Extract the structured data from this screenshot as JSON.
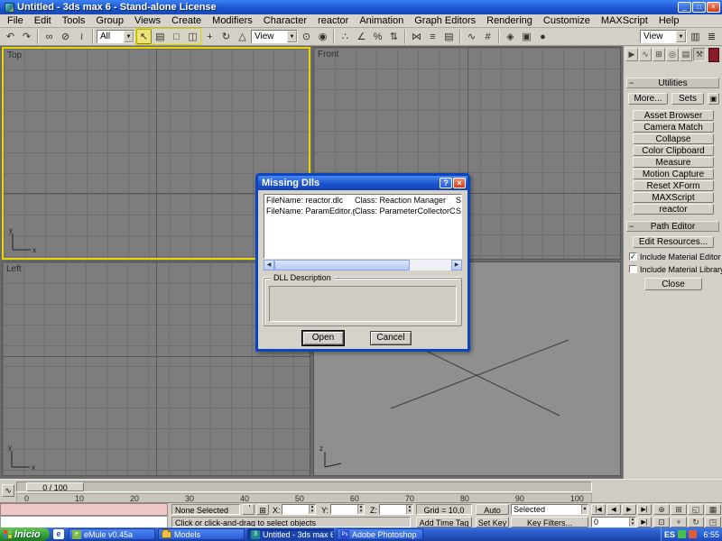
{
  "window": {
    "title": "Untitled - 3ds max 6 - Stand-alone License"
  },
  "menubar": {
    "items": [
      "File",
      "Edit",
      "Tools",
      "Group",
      "Views",
      "Create",
      "Modifiers",
      "Character",
      "reactor",
      "Animation",
      "Graph Editors",
      "Rendering",
      "Customize",
      "MAXScript",
      "Help"
    ]
  },
  "toolbar": {
    "selection_filter": "All",
    "ref_coord": "View",
    "view_right": "View"
  },
  "viewports": {
    "top_label": "Top",
    "front_label": "Front",
    "left_label": "Left",
    "axis_x": "x",
    "axis_y": "y",
    "axis_z": "z"
  },
  "command_panel": {
    "utilities_header": "Utilities",
    "more_label": "More...",
    "sets_label": "Sets",
    "buttons": [
      "Asset Browser",
      "Camera Match",
      "Collapse",
      "Color Clipboard",
      "Measure",
      "Motion Capture",
      "Reset XForm",
      "MAXScript",
      "reactor"
    ],
    "path_editor_header": "Path Editor",
    "edit_resources_label": "Edit Resources...",
    "chk_material_editor": "Include Material Editor",
    "chk_material_library": "Include Material Library",
    "close_label": "Close"
  },
  "dialog": {
    "title": "Missing Dlls",
    "rows": [
      {
        "filename": "FileName: reactor.dlc",
        "klass": "Class: Reaction Manager",
        "superclass": "SuperClass: G"
      },
      {
        "filename": "FileName: ParamEditor.gup",
        "klass": "Class: ParameterCollectorCA",
        "superclass": "SuperClass: G"
      }
    ],
    "group_label": "DLL Description",
    "open_label": "Open",
    "cancel_label": "Cancel"
  },
  "timeline": {
    "slider_label": "0 / 100",
    "ticks": [
      "0",
      "10",
      "20",
      "30",
      "40",
      "50",
      "60",
      "70",
      "80",
      "90",
      "100"
    ]
  },
  "statusbar": {
    "selection_status": "None Selected",
    "x_label": "X:",
    "y_label": "Y:",
    "z_label": "Z:",
    "x_value": "",
    "y_value": "",
    "z_value": "",
    "grid_status": "Grid = 10,0",
    "time_tag": "Add Time Tag",
    "prompt": "Click or click-and-drag to select objects",
    "auto_key": "Auto Key",
    "set_key": "Set Key",
    "key_mode": "Selected",
    "key_filters": "Key Filters...",
    "frame": "0"
  },
  "taskbar": {
    "start": "Inicio",
    "tasks": [
      {
        "label": "eMule v0.45a",
        "icon_text": "e"
      },
      {
        "label": "Models",
        "icon_text": ""
      },
      {
        "label": "Untitled - 3ds max 6 -...",
        "icon_text": "3"
      },
      {
        "label": "Adobe Photoshop",
        "icon_text": "Ps"
      }
    ],
    "lang": "ES",
    "clock": "6:55"
  },
  "icons": {
    "minimize": "_",
    "maximize": "□",
    "close": "×",
    "help": "?",
    "undo": "↶",
    "redo": "↷",
    "link": "∞",
    "unlink": "⊘",
    "bind": "≀",
    "dropdown_arrow": "▼",
    "select": "↖",
    "select_by_name": "▤",
    "region_rect": "□",
    "window_crossing": "◫",
    "move": "+",
    "rotate": "↻",
    "scale": "△",
    "pivot": "⊙",
    "manipulate": "◉",
    "snap_3d": "∴",
    "angle_snap": "∠",
    "percent_snap": "%",
    "spinner_snap": "⇅",
    "mirror": "⋈",
    "align": "≡",
    "layers": "▤",
    "curve_editor": "∿",
    "schematic": "#",
    "material_editor": "◈",
    "render_scene": "▣",
    "quick_render": "●",
    "stack_a": "▥",
    "stack_b": "≣",
    "tab_create": "▶",
    "tab_modify": "∿",
    "tab_hierarchy": "⊞",
    "tab_motion": "◎",
    "tab_display": "▤",
    "tab_utilities": "⚒",
    "minus": "−",
    "configure": "▣",
    "left_arrow": "◀",
    "right_arrow": "▶",
    "check": "✓",
    "pb_start": "|◀",
    "pb_prev": "◀",
    "pb_play": "▶",
    "pb_end": "▶|",
    "spin_up": "▴",
    "spin_down": "▾",
    "offset_mode": "⊞",
    "nav_zoom": "⊕",
    "nav_zoom_all": "⊞",
    "nav_extents": "◱",
    "nav_extents_all": "▦",
    "nav_region": "⊡",
    "nav_pan": "+",
    "nav_arc": "↻",
    "nav_minmax": "◳",
    "mini_curve": "∿"
  },
  "colors": {
    "active_viewport": "#e8d800",
    "titlebar_top": "#3c81f3",
    "titlebar_bottom": "#1a54cf",
    "taskbar_top": "#3168d5",
    "taskbar_bottom": "#1941a5",
    "start_green": "#3fae3f",
    "listener_pink": "#efc7c7",
    "maroon_swatch": "#8b1a2a"
  }
}
